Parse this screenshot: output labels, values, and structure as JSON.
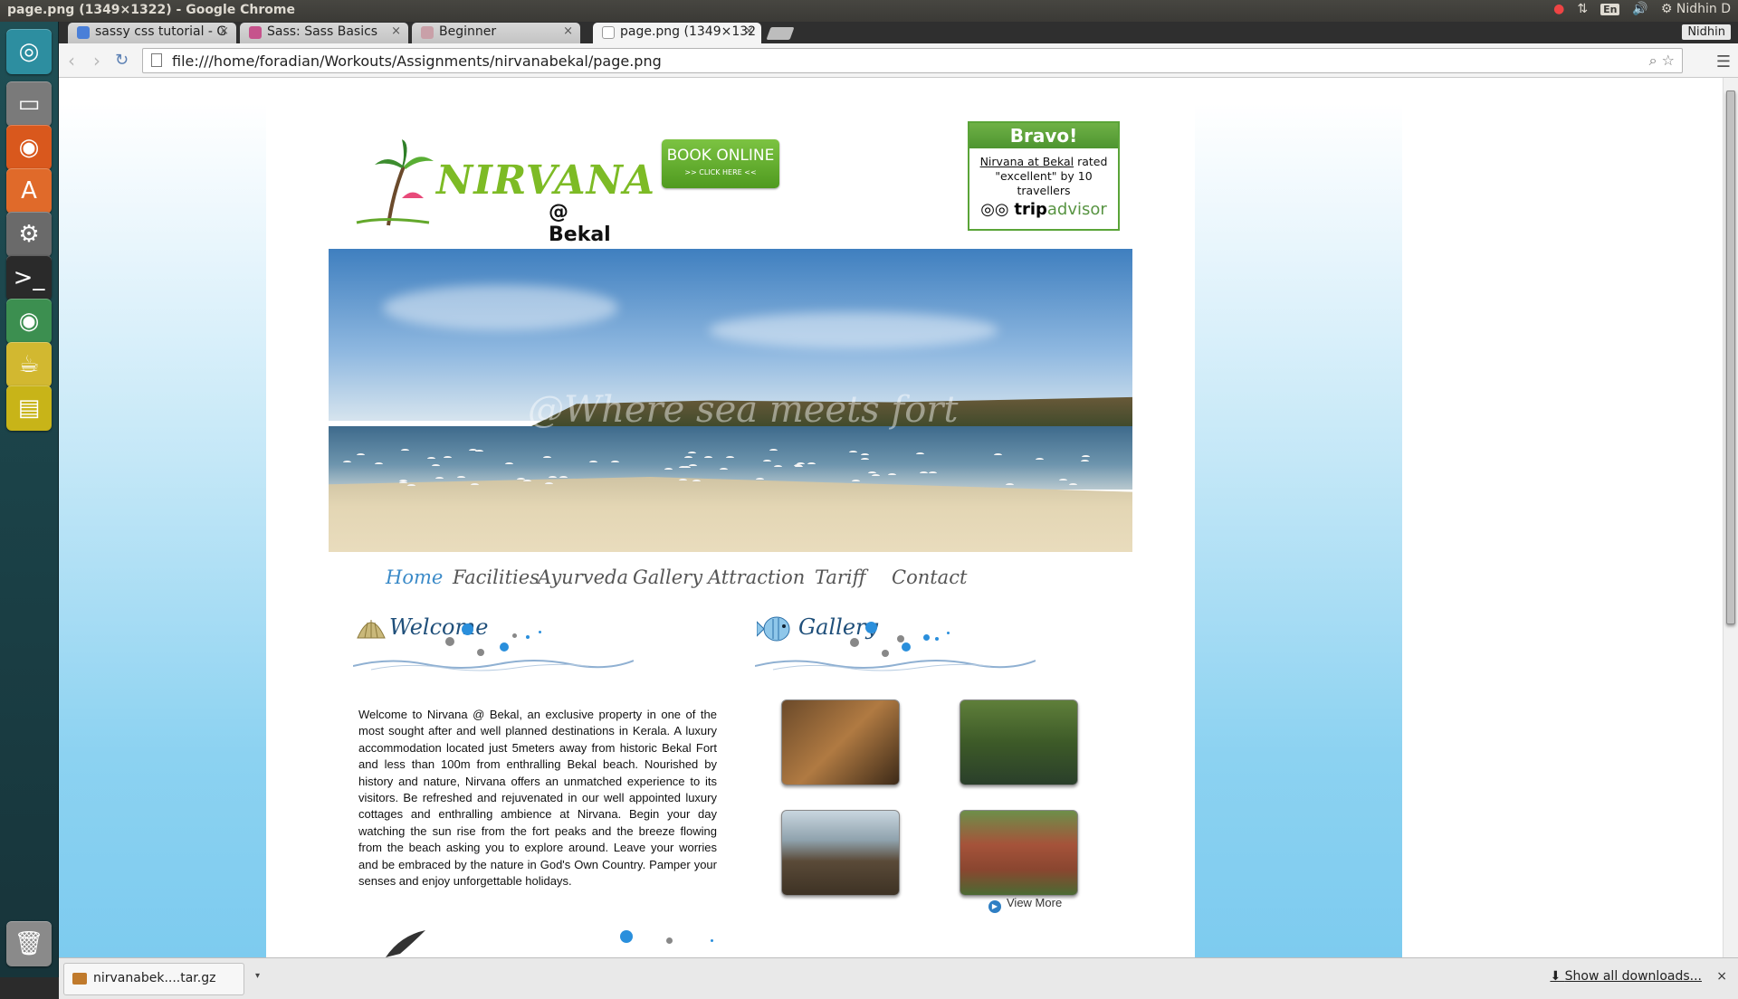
{
  "os": {
    "window_title": "page.png (1349×1322) - Google Chrome",
    "user": "Nidhin D",
    "lang": "En"
  },
  "browser": {
    "tabs": [
      {
        "label": "sassy css tutorial - G"
      },
      {
        "label": "Sass: Sass Basics"
      },
      {
        "label": "Beginner"
      },
      {
        "label": "page.png (1349×132"
      }
    ],
    "profile": "Nidhin",
    "url": "file:///home/foradian/Workouts/Assignments/nirvanabekal/page.png"
  },
  "site": {
    "logo_word": "NIRVANA",
    "logo_sub": "@ Bekal",
    "book_line1": "BOOK ONLINE",
    "book_line2": ">> CLICK HERE <<",
    "bravo": {
      "heading": "Bravo!",
      "link": "Nirvana at Bekal",
      "rest": " rated \"excellent\" by 10 travellers",
      "brand_a": "trip",
      "brand_b": "advisor"
    },
    "hero_watermark": "@Where sea meets fort",
    "nav": [
      "Home",
      "Facilities",
      "Ayurveda",
      "Gallery",
      "Attraction",
      "Tariff",
      "Contact"
    ],
    "welcome_title": "Welcome",
    "gallery_title": "Gallery",
    "welcome_text": "Welcome to Nirvana @ Bekal, an exclusive property in one of the most sought after and well planned destinations in Kerala. A luxury accommodation located just 5meters away from historic Bekal Fort and less than 100m from enthralling Bekal beach. Nourished by history and nature, Nirvana offers an unmatched experience to its visitors. Be refreshed and rejuvenated in our well appointed luxury cottages and enthralling ambience at Nirvana. Begin your day watching the sun rise from the fort peaks and the breeze flowing from the beach asking you to explore around. Leave your worries and be embraced by the nature in God's Own Country. Pamper your senses and enjoy unforgettable holidays.",
    "view_more": "View More"
  },
  "downloads": {
    "file": "nirvanabek....tar.gz",
    "show_all": "Show all downloads..."
  },
  "colors": {
    "accent_green": "#5aa438",
    "nav_active": "#3a8ac8",
    "section_blue": "#1f4f7a"
  }
}
